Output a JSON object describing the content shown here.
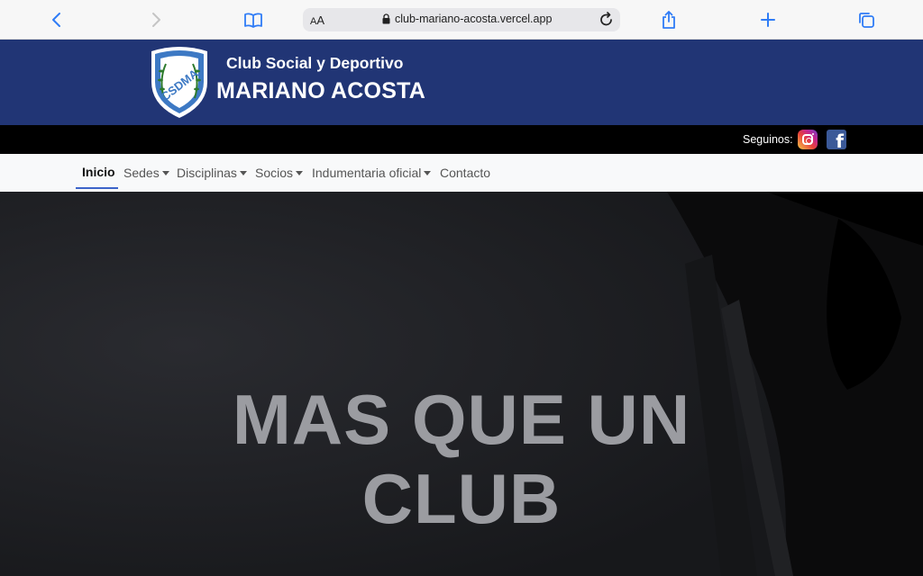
{
  "browser": {
    "text_size_label_small": "A",
    "text_size_label_big": "A",
    "url": "club-mariano-acosta.vercel.app",
    "accent": "#2f7cf6"
  },
  "header": {
    "subtitle": "Club Social y Deportivo",
    "title": "MARIANO ACOSTA",
    "logo_text": "CSDMA",
    "background": "#213575"
  },
  "social": {
    "label": "Seguinos:",
    "links": [
      {
        "name": "instagram"
      },
      {
        "name": "facebook",
        "glyph": "f"
      }
    ]
  },
  "nav": {
    "items": [
      {
        "label": "Inicio",
        "active": true
      },
      {
        "label": "Sedes",
        "dropdown": true
      },
      {
        "label": "Disciplinas",
        "dropdown": true
      },
      {
        "label": "Socios",
        "dropdown": true
      },
      {
        "label": "Indumentaria oficial",
        "dropdown": true
      },
      {
        "label": "Contacto"
      }
    ]
  },
  "hero": {
    "line1": "MAS QUE UN",
    "line2": "CLUB"
  }
}
